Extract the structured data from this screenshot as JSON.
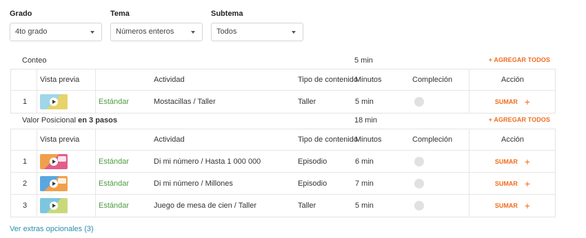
{
  "filters": [
    {
      "label": "Grado",
      "value": "4to grado"
    },
    {
      "label": "Tema",
      "value": "Números enteros"
    },
    {
      "label": "Subtema",
      "value": "Todos"
    }
  ],
  "columns": {
    "preview": "Vista previa",
    "activity": "Actividad",
    "type": "Tipo de contenido",
    "minutes": "Minutos",
    "completion": "Compleción",
    "action": "Acción"
  },
  "add_all_label": "+ AGREGAR TODOS",
  "sumar_label": "SUMAR",
  "plus_glyph": "+",
  "sections": [
    {
      "name": "Conteo",
      "name_bold": "",
      "minutes": "5 min",
      "rows": [
        {
          "num": "1",
          "standard": "Estándar",
          "activity": "Mostacillas / Taller",
          "type": "Taller",
          "minutes": "5 min",
          "thumb_colors": [
            "#9fd6e8",
            "#e8d36a"
          ]
        }
      ]
    },
    {
      "name": "Valor Posicional",
      "name_bold": "en 3 pasos",
      "minutes": "18 min",
      "rows": [
        {
          "num": "1",
          "standard": "Estándar",
          "activity": "Di mi número / Hasta 1 000 000",
          "type": "Episodio",
          "minutes": "6 min",
          "thumb_colors": [
            "#f0a04b",
            "#e25d8a"
          ]
        },
        {
          "num": "2",
          "standard": "Estándar",
          "activity": "Di mi número / Millones",
          "type": "Episodio",
          "minutes": "7 min",
          "thumb_colors": [
            "#5aa7e0",
            "#f0a04b"
          ]
        },
        {
          "num": "3",
          "standard": "Estándar",
          "activity": "Juego de mesa de cien / Taller",
          "type": "Taller",
          "minutes": "5 min",
          "thumb_colors": [
            "#7cc6e0",
            "#c9d97a"
          ]
        }
      ]
    }
  ],
  "extras_link": "Ver extras opcionales (3)",
  "colors": {
    "accent": "#f26b1d",
    "standard_green": "#4e9a3f",
    "link_blue": "#2a8bb0"
  }
}
